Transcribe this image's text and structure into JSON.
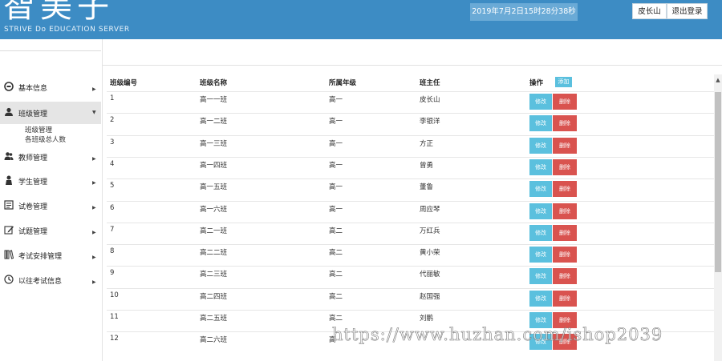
{
  "header": {
    "logo_text": "智美子",
    "logo_subtitle": "STRIVE Do EDUCATION SERVER",
    "datetime": "2019年7月2日15时28分38秒",
    "user_name": "皮长山",
    "logout_label": "退出登录",
    "colors": {
      "bar": "#3d8cc4",
      "datetime_bg": "#6aaad6"
    }
  },
  "sidebar": {
    "items": [
      {
        "label": "基本信息",
        "icon": "info-icon"
      },
      {
        "label": "班级管理",
        "icon": "user-icon",
        "active": true,
        "children": [
          "班级管理",
          "各班级总人数"
        ]
      },
      {
        "label": "教师管理",
        "icon": "users-icon"
      },
      {
        "label": "学生管理",
        "icon": "student-icon"
      },
      {
        "label": "试卷管理",
        "icon": "document-icon"
      },
      {
        "label": "试题管理",
        "icon": "edit-icon"
      },
      {
        "label": "考试安排管理",
        "icon": "books-icon"
      },
      {
        "label": "以往考试信息",
        "icon": "clock-icon"
      }
    ]
  },
  "table": {
    "headers": {
      "id": "班级编号",
      "name": "班级名称",
      "grade": "所属年级",
      "teacher": "班主任",
      "actions": "操作"
    },
    "add_label": "添加",
    "edit_label": "修改",
    "delete_label": "删除",
    "rows": [
      {
        "id": "1",
        "name": "高一一班",
        "grade": "高一",
        "teacher": "皮长山"
      },
      {
        "id": "2",
        "name": "高一二班",
        "grade": "高一",
        "teacher": "李银洋"
      },
      {
        "id": "3",
        "name": "高一三班",
        "grade": "高一",
        "teacher": "方正"
      },
      {
        "id": "4",
        "name": "高一四班",
        "grade": "高一",
        "teacher": "曾勇"
      },
      {
        "id": "5",
        "name": "高一五班",
        "grade": "高一",
        "teacher": "董鲁"
      },
      {
        "id": "6",
        "name": "高一六班",
        "grade": "高一",
        "teacher": "周应琴"
      },
      {
        "id": "7",
        "name": "高二一班",
        "grade": "高二",
        "teacher": "万红兵"
      },
      {
        "id": "8",
        "name": "高二二班",
        "grade": "高二",
        "teacher": "黄小荣"
      },
      {
        "id": "9",
        "name": "高二三班",
        "grade": "高二",
        "teacher": "代丽敏"
      },
      {
        "id": "10",
        "name": "高二四班",
        "grade": "高二",
        "teacher": "赵国强"
      },
      {
        "id": "11",
        "name": "高二五班",
        "grade": "高二",
        "teacher": "刘鹏"
      },
      {
        "id": "12",
        "name": "高二六班",
        "grade": "高",
        "teacher": ""
      }
    ],
    "colors": {
      "edit": "#5bc0de",
      "delete": "#d9534f"
    }
  },
  "watermark": "https://www.huzhan.com/ishop2039"
}
